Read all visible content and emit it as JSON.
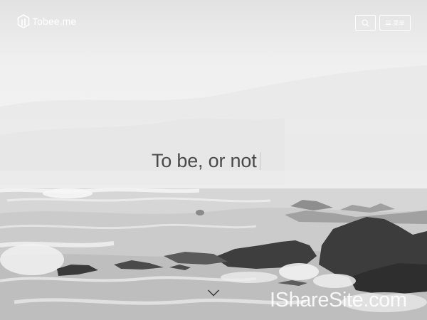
{
  "header": {
    "logo": {
      "text": "Tobee.me",
      "icon": "cube-logo-icon"
    },
    "search_button": {
      "icon": "search-icon"
    },
    "menu_button": {
      "icon": "menu-icon",
      "label": "菜单"
    }
  },
  "hero": {
    "tagline": "To be, or not",
    "scroll_icon": "chevron-down-icon",
    "background": "misty grayscale seascape with rocks and crashing waves"
  },
  "watermark": {
    "text": "IShareSite.com"
  },
  "colors": {
    "header_text": "#ffffff",
    "tagline": "#4a4a4a",
    "caret": "#c5c5c5"
  }
}
